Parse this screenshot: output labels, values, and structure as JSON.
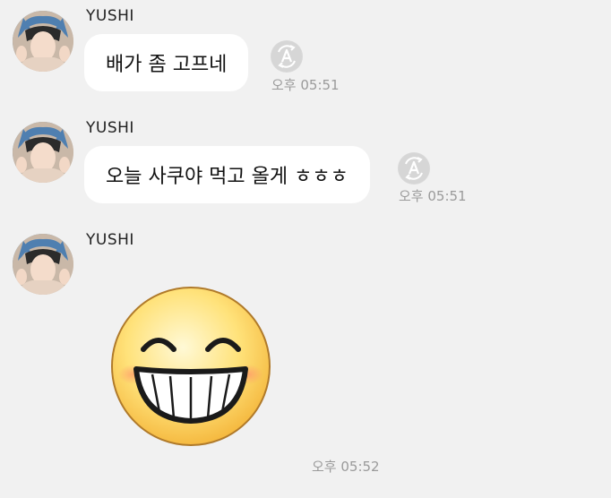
{
  "messages": [
    {
      "sender": "YUSHI",
      "text": "배가 좀 고프네",
      "time": "오후 05:51"
    },
    {
      "sender": "YUSHI",
      "text": "오늘 사쿠야 먹고 올게 ㅎㅎㅎ",
      "time": "오후 05:51"
    },
    {
      "sender": "YUSHI",
      "sticker": "grinning-face-sticker",
      "time": "오후 05:52"
    }
  ],
  "icons": {
    "translate": "translate-a-icon"
  },
  "colors": {
    "background": "#f1f1f1",
    "bubble": "#ffffff",
    "timestamp": "#9a9a9a"
  }
}
